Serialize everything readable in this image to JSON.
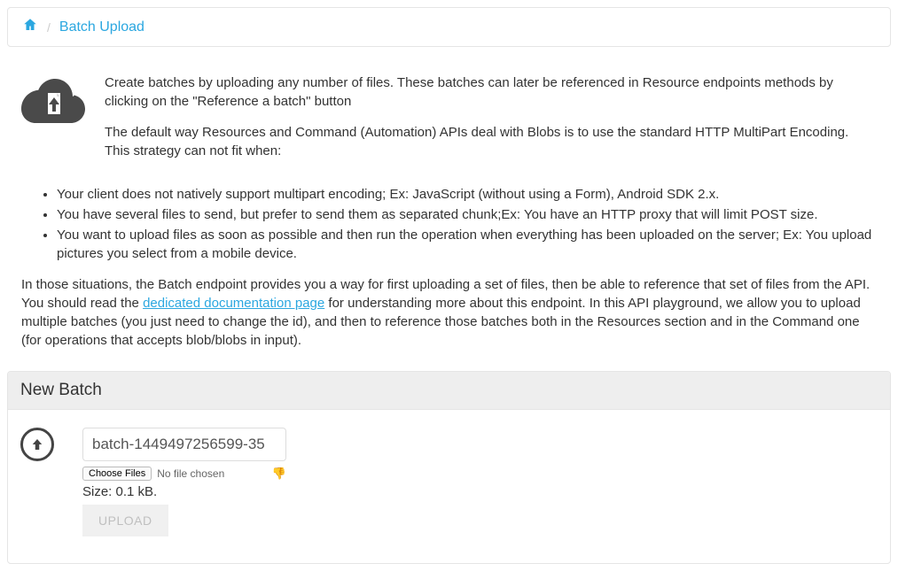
{
  "breadcrumb": {
    "current": "Batch Upload"
  },
  "intro": {
    "p1": "Create batches by uploading any number of files. These batches can later be referenced in Resource endpoints methods by clicking on the \"Reference a batch\" button",
    "p2": "The default way Resources and Command (Automation) APIs deal with Blobs is to use the standard HTTP MultiPart Encoding. This strategy can not fit when:"
  },
  "bullets": [
    "Your client does not natively support multipart encoding; Ex: JavaScript (without using a Form), Android SDK 2.x.",
    "You have several files to send, but prefer to send them as separated chunk;Ex: You have an HTTP proxy that will limit POST size.",
    "You want to upload files as soon as possible and then run the operation when everything has been uploaded on the server; Ex: You upload pictures you select from a mobile device."
  ],
  "outro": {
    "pre": "In those situations, the Batch endpoint provides you a way for first uploading a set of files, then be able to reference that set of files from the API. You should read the ",
    "link": "dedicated documentation page",
    "post": " for understanding more about this endpoint. In this API playground, we allow you to upload multiple batches (you just need to change the id), and then to reference those batches both in the Resources section and in the Command one (for operations that accepts blob/blobs in input)."
  },
  "panel": {
    "title": "New Batch",
    "batch_id": "batch-1449497256599-35",
    "choose_label": "Choose Files",
    "file_status": "No file chosen",
    "size_text": "Size: 0.1 kB.",
    "upload_label": "UPLOAD"
  }
}
